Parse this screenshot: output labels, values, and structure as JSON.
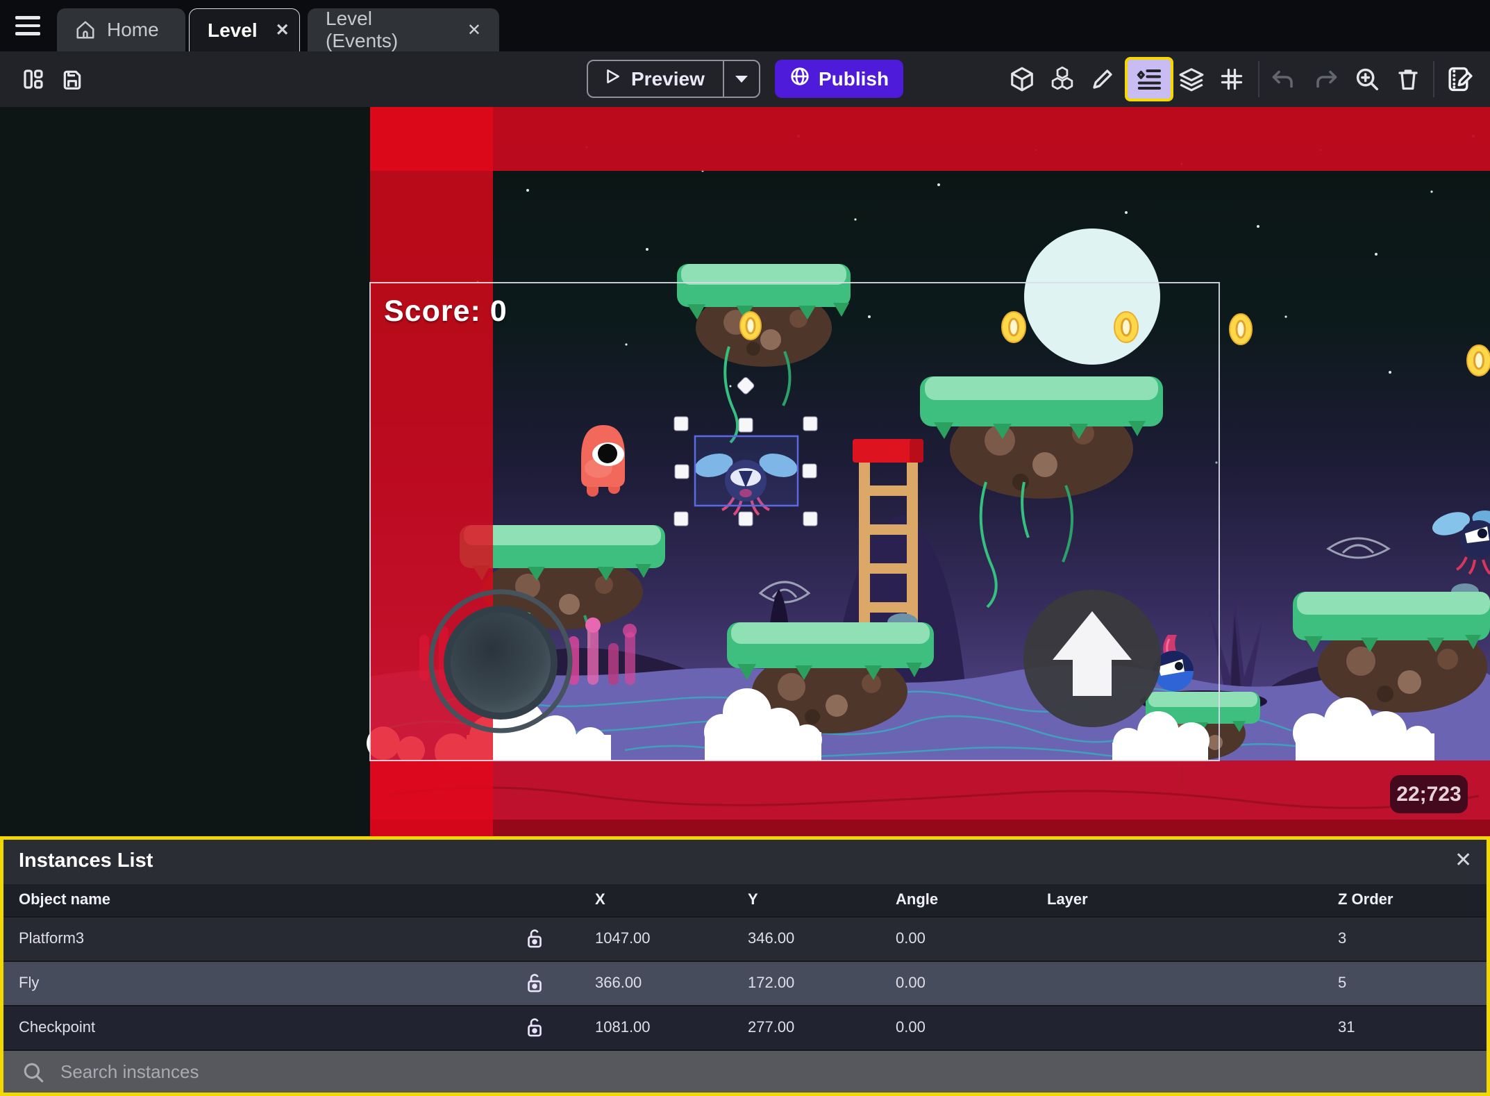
{
  "tabs": {
    "home": {
      "label": "Home"
    },
    "level": {
      "label": "Level",
      "close": "✕"
    },
    "level_events": {
      "label": "Level (Events)",
      "close": "✕"
    }
  },
  "toolbar": {
    "preview_label": "Preview",
    "publish_label": "Publish"
  },
  "hud": {
    "score_text": "Score: 0",
    "coords_badge": "22;723"
  },
  "instances_panel": {
    "title": "Instances List",
    "close": "✕",
    "columns": [
      "Object name",
      "X",
      "Y",
      "Angle",
      "Layer",
      "Z Order"
    ],
    "rows": [
      {
        "name": "Platform3",
        "x": "1047.00",
        "y": "346.00",
        "angle": "0.00",
        "layer": "",
        "z_order": "3"
      },
      {
        "name": "Fly",
        "x": "366.00",
        "y": "172.00",
        "angle": "0.00",
        "layer": "",
        "z_order": "5"
      },
      {
        "name": "Checkpoint",
        "x": "1081.00",
        "y": "277.00",
        "angle": "0.00",
        "layer": "",
        "z_order": "31"
      }
    ],
    "search_placeholder": "Search instances"
  },
  "colors": {
    "accent_purple": "#4d1bd9",
    "highlight_yellow": "#f2d800",
    "selection_blue": "#5a6ae0",
    "red_overlay": "#c11232"
  }
}
